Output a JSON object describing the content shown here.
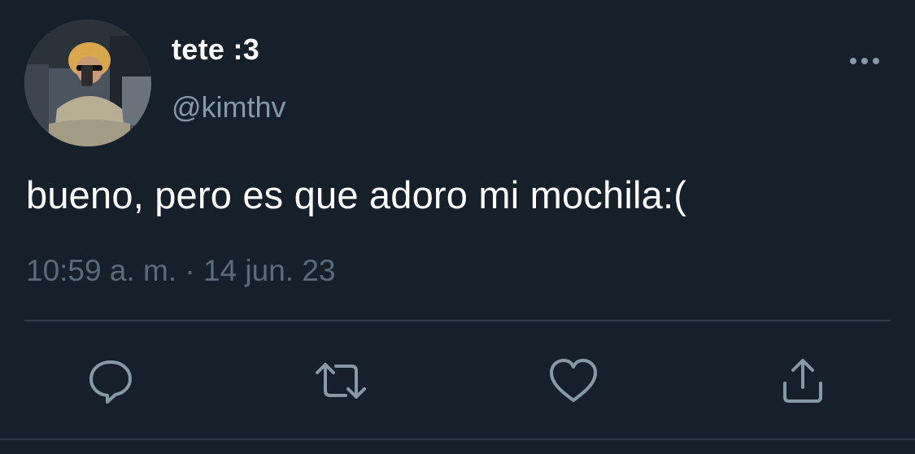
{
  "user": {
    "display_name": "tete :3",
    "handle": "@kimthv"
  },
  "tweet": {
    "text": "bueno, pero es que adoro mi mochila:(",
    "timestamp": "10:59 a. m. · 14 jun. 23"
  },
  "icons": {
    "more": "more-horizontal-icon",
    "reply": "reply-icon",
    "retweet": "retweet-icon",
    "like": "heart-icon",
    "share": "share-icon"
  },
  "colors": {
    "background": "#15202b",
    "primary_text": "#ffffff",
    "secondary_text": "#8899a6",
    "timestamp_text": "#5b6b7a",
    "icon": "#8899a6",
    "divider": "#2f3b47"
  }
}
